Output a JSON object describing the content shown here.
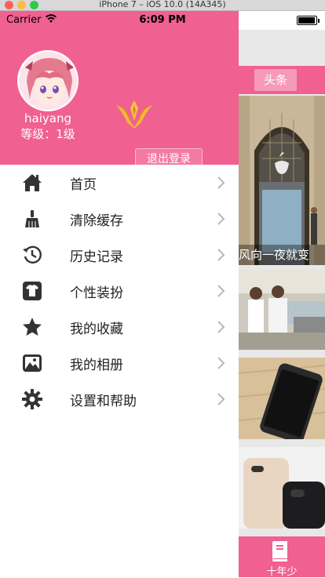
{
  "simulator": {
    "title": "iPhone 7 – iOS 10.0 (14A345)"
  },
  "statusbar": {
    "carrier": "Carrier",
    "time": "6:09 PM"
  },
  "profile": {
    "username": "haiyang",
    "level": "等级：1级",
    "logout_label": "退出登录"
  },
  "menu": {
    "items": [
      {
        "label": "首页",
        "icon": "home-icon"
      },
      {
        "label": "清除缓存",
        "icon": "broom-icon"
      },
      {
        "label": "历史记录",
        "icon": "history-icon"
      },
      {
        "label": "个性装扮",
        "icon": "tshirt-icon"
      },
      {
        "label": "我的收藏",
        "icon": "star-icon"
      },
      {
        "label": "我的相册",
        "icon": "photo-icon"
      },
      {
        "label": "设置和帮助",
        "icon": "gear-icon"
      }
    ]
  },
  "news": {
    "header_label": "头条",
    "caption": "风向一夜就变"
  },
  "bottom_tab": {
    "label": "十年少",
    "icon": "book-icon"
  },
  "colors": {
    "primary_pink": "#f06090",
    "text": "#222222"
  }
}
